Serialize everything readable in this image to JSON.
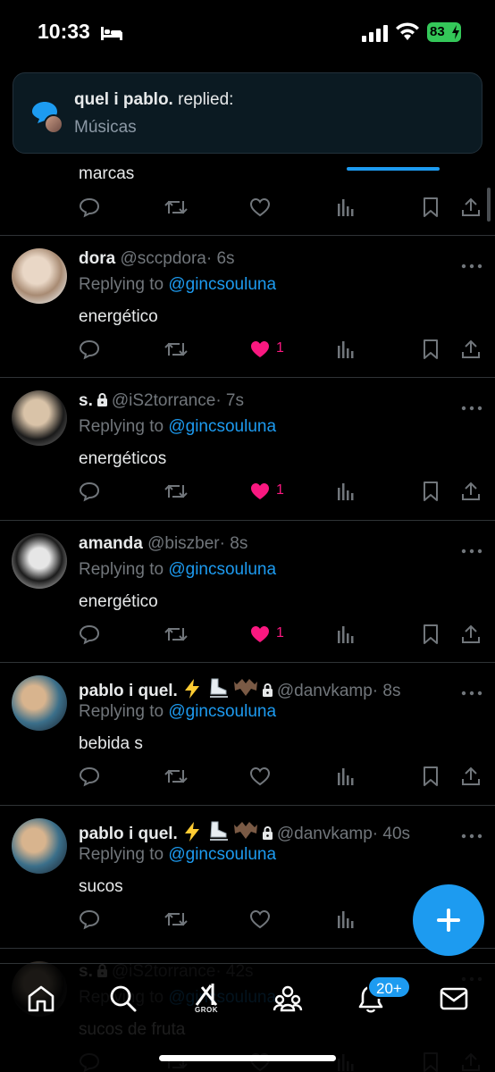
{
  "status_bar": {
    "time": "10:33",
    "battery": "83"
  },
  "notification": {
    "name": "quel i pablo.",
    "action": " replied:",
    "subtitle": "Músicas"
  },
  "partial_top_tweet": {
    "text": "marcas"
  },
  "tweets": [
    {
      "name": "dora",
      "handle": "@sccpdora",
      "time": "· 6s",
      "replying_prefix": "Replying to ",
      "replying_to": "@gincsouluna",
      "text": "energético",
      "likes": "1",
      "liked": true,
      "locked": false,
      "emoji": false
    },
    {
      "name": "s.",
      "handle": "@iS2torrance",
      "time": "· 7s",
      "replying_prefix": "Replying to ",
      "replying_to": "@gincsouluna",
      "text": "energéticos",
      "likes": "1",
      "liked": true,
      "locked": true,
      "emoji": false
    },
    {
      "name": "amanda",
      "handle": "@biszber",
      "time": "· 8s",
      "replying_prefix": "Replying to ",
      "replying_to": "@gincsouluna",
      "text": "energético",
      "likes": "1",
      "liked": true,
      "locked": false,
      "emoji": false
    },
    {
      "name": "pablo i quel.",
      "handle": "@danvkamp",
      "time": "· 8s",
      "replying_prefix": "Replying to ",
      "replying_to": "@gincsouluna",
      "text": "bebida s",
      "likes": "",
      "liked": false,
      "locked": true,
      "emoji": true
    },
    {
      "name": "pablo i quel.",
      "handle": "@danvkamp",
      "time": "· 40s",
      "replying_prefix": "Replying to ",
      "replying_to": "@gincsouluna",
      "text": "sucos",
      "likes": "",
      "liked": false,
      "locked": true,
      "emoji": true
    },
    {
      "name": "s.",
      "handle": "@iS2torrance",
      "time": "· 42s",
      "replying_prefix": "Replying to ",
      "replying_to": "@gincsouluna",
      "text": "sucos de fruta",
      "likes": "",
      "liked": false,
      "locked": true,
      "emoji": false
    }
  ],
  "bottom_nav": {
    "grok_label": "GROK",
    "notifications_badge": "20+"
  },
  "colors": {
    "accent": "#1d9bf0",
    "like": "#f91880",
    "muted": "#71767b",
    "background": "#000000"
  }
}
